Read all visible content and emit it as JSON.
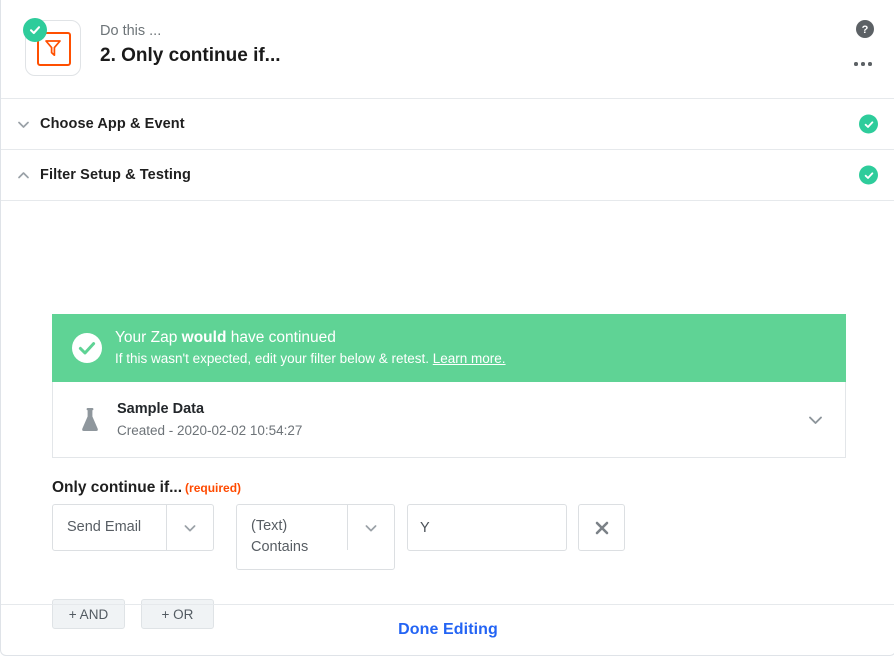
{
  "step_header": {
    "eyebrow": "Do this ...",
    "title": "2. Only continue if...",
    "app_icon_name": "filter-funnel-icon",
    "status": "complete",
    "help_icon": "help-circle-icon",
    "menu_icon": "more-options-icon"
  },
  "sections": [
    {
      "label": "Choose App & Event",
      "expanded": false,
      "chevron": "chevron-down-icon",
      "status": "complete"
    },
    {
      "label": "Filter Setup & Testing",
      "expanded": true,
      "chevron": "chevron-up-icon",
      "status": "complete"
    }
  ],
  "result_banner": {
    "icon": "check-circle-icon",
    "title_prefix": "Your Zap ",
    "title_bold": "would",
    "title_suffix": " have continued",
    "subtitle": "If this wasn't expected, edit your filter below & retest.",
    "link_text": "Learn more.",
    "background_color": "#5fd395"
  },
  "sample_data": {
    "icon": "flask-icon",
    "title": "Sample Data",
    "subtitle": "Created - 2020-02-02 10:54:27",
    "chevron": "chevron-down-icon"
  },
  "filter": {
    "label": "Only continue if...",
    "required_note": "(required)",
    "required_color": "#ff4a00",
    "field_select": {
      "value": "Send Email",
      "chevron": "chevron-down-icon"
    },
    "operator_select": {
      "value": "(Text)\nContains",
      "chevron": "chevron-down-icon"
    },
    "value_input": {
      "value": "Y",
      "placeholder": ""
    },
    "remove_button_icon": "close-x-icon",
    "logic_buttons": [
      {
        "label": "+ AND"
      },
      {
        "label": "+ OR"
      }
    ]
  },
  "footer": {
    "done_label": "Done Editing",
    "done_color": "#2364f4"
  }
}
